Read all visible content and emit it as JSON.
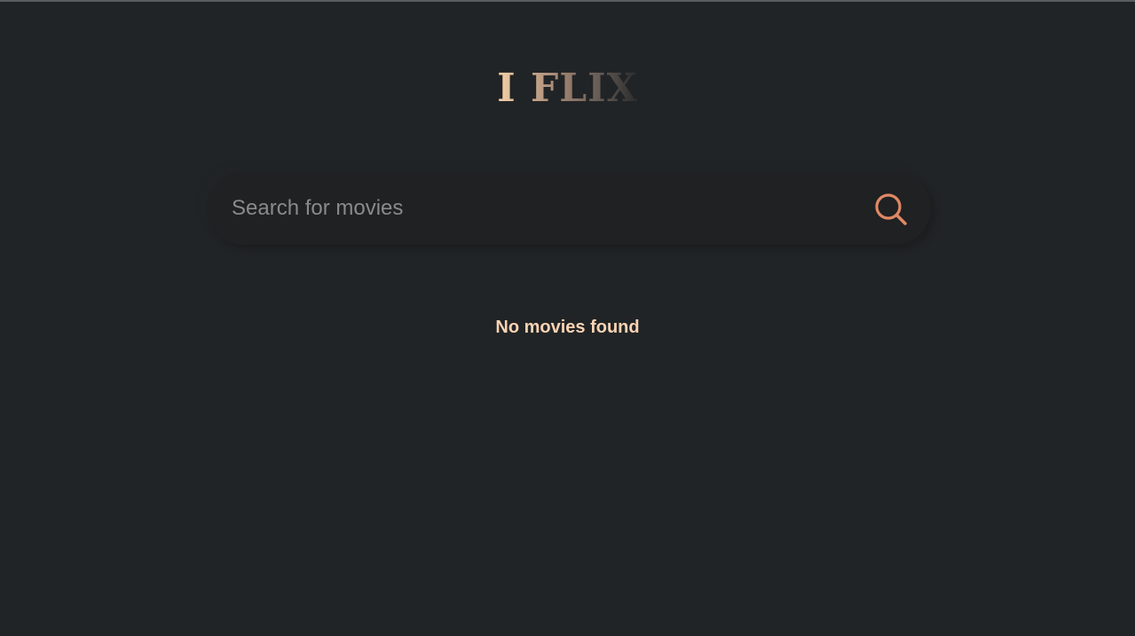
{
  "app": {
    "title": "I FLIX"
  },
  "search": {
    "placeholder": "Search for movies",
    "value": "",
    "icon": "search-icon"
  },
  "results": {
    "empty_message": "No movies found"
  },
  "colors": {
    "background": "#212426",
    "accent": "#e08864",
    "empty_text": "#f9d3b4"
  }
}
